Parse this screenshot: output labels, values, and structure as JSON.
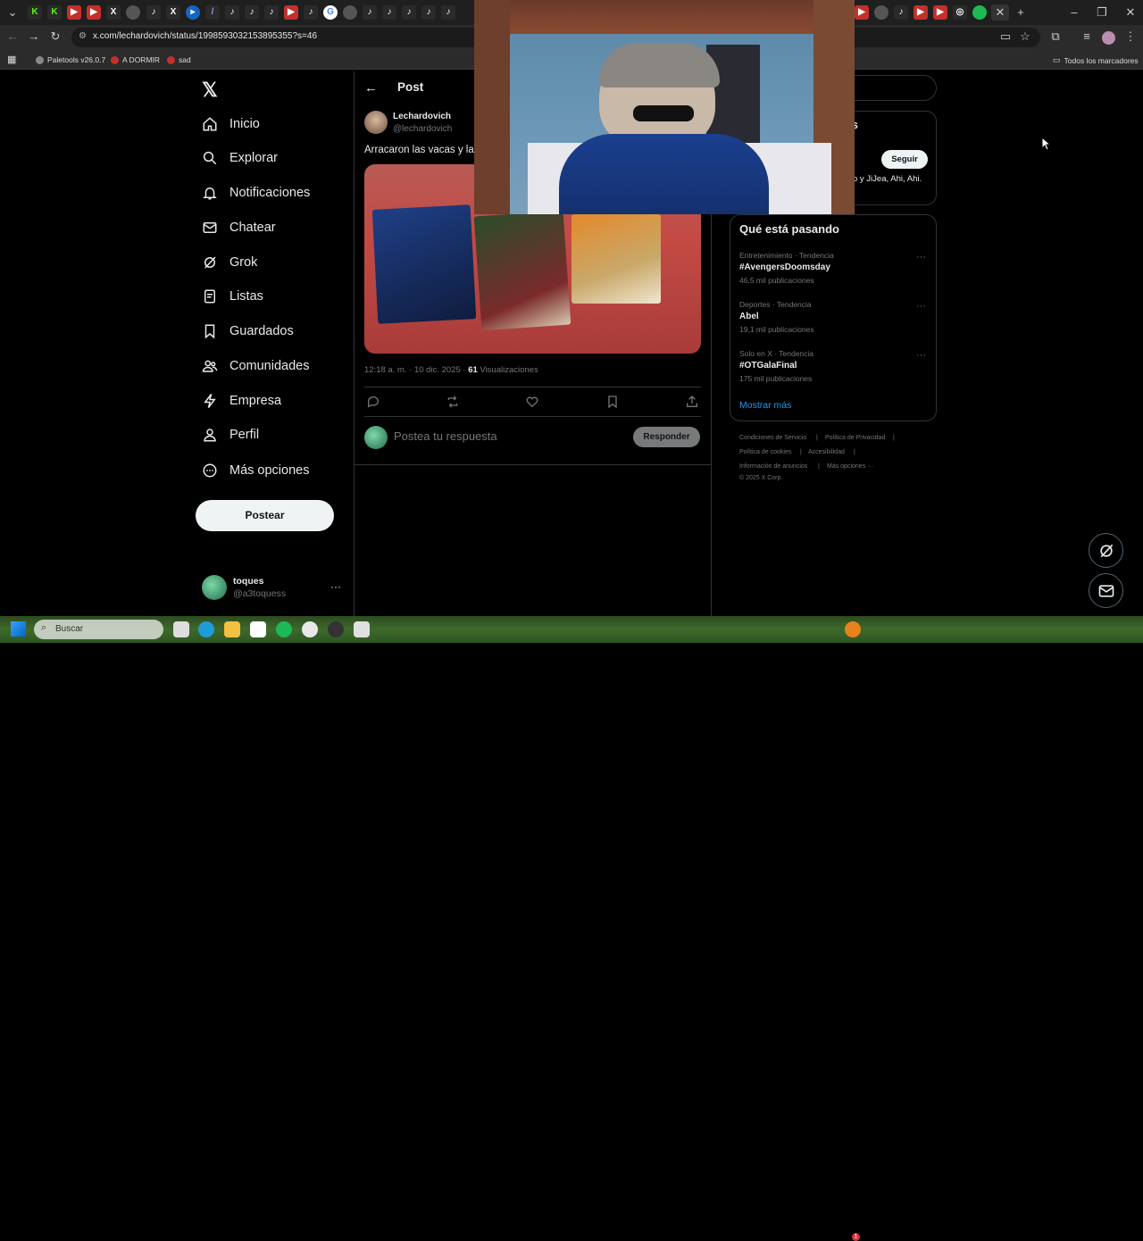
{
  "browser": {
    "url": "x.com/lechardovich/status/1998593032153895355?s=46",
    "bookmarks": [
      "Paletools v26.0.7",
      "A DORMIR",
      "sad"
    ],
    "bookmarks_right": "Todos los marcadores"
  },
  "nav": {
    "items": [
      "Inicio",
      "Explorar",
      "Notificaciones",
      "Chatear",
      "Grok",
      "Listas",
      "Guardados",
      "Comunidades",
      "Empresa",
      "Perfil",
      "Más opciones"
    ],
    "post_button": "Postear"
  },
  "account": {
    "name": "toques",
    "handle": "@a3toquess",
    "more": "···"
  },
  "post": {
    "header_title": "Post",
    "author_name": "Lechardovich",
    "author_handle": "@lechardovich",
    "text": "Arracaron las vacas y la",
    "time": "12:18 a. m. · 10 dic. 2025 · ",
    "views_count": "61",
    "views_label": " Visualizaciones"
  },
  "reply": {
    "placeholder": "Postea tu respuesta",
    "button": "Responder"
  },
  "who_to_follow": {
    "title_fragment": "s",
    "follow_button": "Seguir",
    "followed_by_fragment": "o y JiJea, Ahi, Ahi."
  },
  "trends": {
    "title": "Qué está pasando",
    "items": [
      {
        "category": "Entretenimiento · Tendencia",
        "name": "#AvengersDoomsday",
        "count": "46,5 mil publicaciones"
      },
      {
        "category": "Deportes · Tendencia",
        "name": "Abel",
        "count": "19,1 mil publicaciones"
      },
      {
        "category": "Solo en X · Tendencia",
        "name": "#OTGalaFinal",
        "count": "175 mil publicaciones"
      }
    ],
    "more_icon": "···",
    "show_more": "Mostrar más"
  },
  "footer": {
    "links": [
      "Condiciones de Servicio",
      "Política de Privacidad",
      "Política de cookies",
      "Accesibilidad",
      "Información de anuncios",
      "Más opciones ···"
    ],
    "separator": "|",
    "copyright": "© 2025 X Corp."
  },
  "taskbar": {
    "search_label": "Buscar",
    "badge": "1"
  },
  "colors": {
    "accent": "#1d9bf0",
    "background": "#000000",
    "text_primary": "#e7e9ea",
    "text_secondary": "#71767b"
  }
}
